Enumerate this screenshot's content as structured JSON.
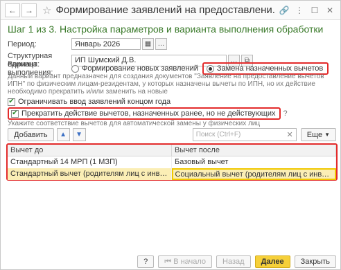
{
  "window": {
    "title": "Формирование заявлений на предоставлени...",
    "back_icon": "←",
    "forward_icon": "→"
  },
  "step_title": "Шаг 1 из 3. Настройка параметров и варианта выполнения обработки",
  "period": {
    "label": "Период:",
    "value": "Январь 2026"
  },
  "org": {
    "label": "Структурная единица:",
    "value": "ИП Шумский Д.В."
  },
  "variant": {
    "label": "Вариант выполнения:",
    "options": [
      "Формирование новых заявлений",
      "Замена назначенных вычетов"
    ],
    "selected_index": 1
  },
  "description": "Данный вариант предназначен для создания документов \"Заявление на предоставление вычетов ИПН\" по физическим лицам-резидентам, у которых назначены вычеты по ИПН, но их действие необходимо прекратить и/или заменить на новые",
  "checkbox_limit": {
    "label": "Ограничивать ввод заявлений концом года",
    "checked": true
  },
  "checkbox_stop": {
    "label": "Прекратить действие вычетов, назначенных ранее, но не действующих",
    "checked": true,
    "help": "?"
  },
  "hint": "Укажите соответствие вычетов для автоматической замены у физических лиц",
  "toolbar": {
    "add_label": "Добавить",
    "search_placeholder": "Поиск (Ctrl+F)",
    "more_label": "Еще"
  },
  "table": {
    "columns": [
      "Вычет до",
      "Вычет после"
    ],
    "rows": [
      [
        "Стандартный 14 МРП (1 МЗП)",
        "Базовый вычет"
      ],
      [
        "Стандартный вычет (родителям лиц с инвалидностью, п...",
        "Социальный вычет (родителям лиц с инвалидностью, по..."
      ]
    ],
    "selected_row": 1
  },
  "footer": {
    "help_label": "?",
    "start_label": "В начало",
    "back_label": "Назад",
    "next_label": "Далее",
    "close_label": "Закрыть"
  },
  "colors": {
    "highlight": "#e32b2b",
    "step_title": "#3a7a2a",
    "primary_button": "#f6d03a"
  }
}
